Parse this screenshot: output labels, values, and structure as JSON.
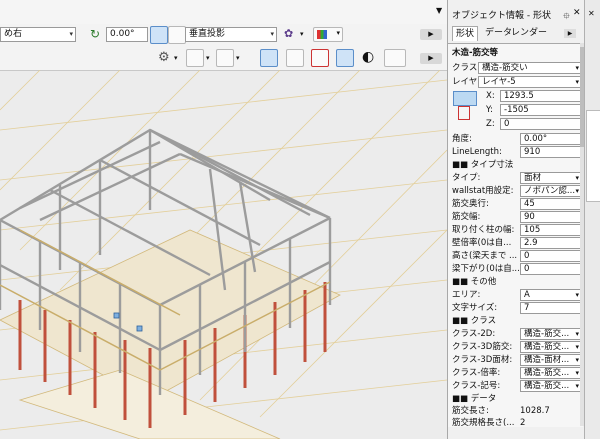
{
  "toolbar1": {
    "class_field": "め右",
    "angle_value": "0.00°",
    "projection": "垂直投影"
  },
  "panel": {
    "title": "オブジェクト情報 - 形状",
    "tabs": [
      "形状",
      "データ",
      "レンダー"
    ],
    "object_type": "木造-筋交等",
    "class_label": "クラス:",
    "class_value": "構造-筋交い",
    "layer_label": "レイヤ:",
    "layer_value": "レイヤ-5",
    "x_label": "X:",
    "x_value": "1293.5",
    "y_label": "Y:",
    "y_value": "-1505",
    "z_label": "Z:",
    "z_value": "0",
    "angle_label": "角度:",
    "angle_value": "0.00°",
    "linelength_label": "LineLength:",
    "linelength_value": "910",
    "sect_dims": "■■ タイプ寸法",
    "type_label": "タイプ:",
    "type_value": "面材",
    "wallstat_label": "wallstat用設定:",
    "wallstat_value": "ノボパン認...",
    "depth_label": "筋交奥行:",
    "depth_value": "45",
    "width_label": "筋交幅:",
    "width_value": "90",
    "pillar_label": "取り付く柱の幅:",
    "pillar_value": "105",
    "ratio_label": "壁倍率(0は自...",
    "ratio_value": "2.9",
    "height_label": "高さ(梁天まで ...",
    "height_value": "0",
    "beam_label": "梁下がり(0は自...",
    "beam_value": "0",
    "sect_other": "■■ その他",
    "area_label": "エリア:",
    "area_value": "A",
    "font_label": "文字サイズ:",
    "font_value": "7",
    "sect_class": "■■ クラス",
    "c2d_label": "クラス-2D:",
    "c2d_value": "構造-筋交...",
    "c3d_label": "クラス-3D筋交:",
    "c3d_value": "構造-筋交...",
    "c3dm_label": "クラス-3D面材:",
    "c3dm_value": "構造-面材...",
    "cratio_label": "クラス-倍率:",
    "cratio_value": "構造-筋交...",
    "csym_label": "クラス-記号:",
    "csym_value": "構造-筋交...",
    "sect_data": "■■ データ",
    "len_label": "筋交長さ:",
    "len_value": "1028.7",
    "std_label": "筋交規格長さ(...",
    "std_value": "2"
  },
  "colors": {
    "frame": "#b9b9b9",
    "post": "#c0503c",
    "grid": "#e3cf9a",
    "panel_bg": "#f6f6f6"
  }
}
